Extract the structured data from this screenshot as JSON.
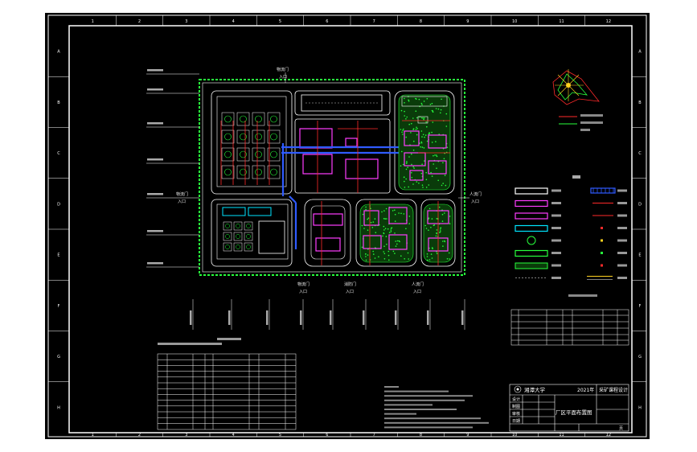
{
  "colors": {
    "canvas": "#000000",
    "outer": "#ffffff",
    "frame": "#ffffff",
    "road": "#ffffff",
    "building_cyan": "#00e5ff",
    "building_magenta": "#ff3cff",
    "green": "#27ff3c",
    "pipe_blue": "#2f5bff",
    "red_line": "#ff2a2a",
    "yellow": "#ffd21f",
    "grid_text": "#ffffff"
  },
  "icons": {
    "compass": "wind-rose-icon",
    "school_logo": "university-seal-icon"
  },
  "frame_numbers": {
    "top": [
      "1",
      "2",
      "3",
      "4",
      "5",
      "6",
      "7",
      "8",
      "9",
      "10",
      "11",
      "12"
    ],
    "left": [
      "A",
      "B",
      "C",
      "D",
      "E",
      "F",
      "G",
      "H"
    ],
    "right": [
      "A",
      "B",
      "C",
      "D",
      "E",
      "F",
      "G",
      "H"
    ]
  },
  "site": {
    "entrances": {
      "top": "入口",
      "left": "入口",
      "right": "入口",
      "bottom1": "入口",
      "bottom2": "入口",
      "bottom3": "入口"
    }
  },
  "title_block": {
    "school": "湘潭大学",
    "year": "2021年",
    "course": "采矿课程设计",
    "drawing_title": "厂区平面布置图",
    "row_labels": [
      "设计",
      "制图",
      "审核",
      "日期"
    ],
    "page": "页"
  }
}
